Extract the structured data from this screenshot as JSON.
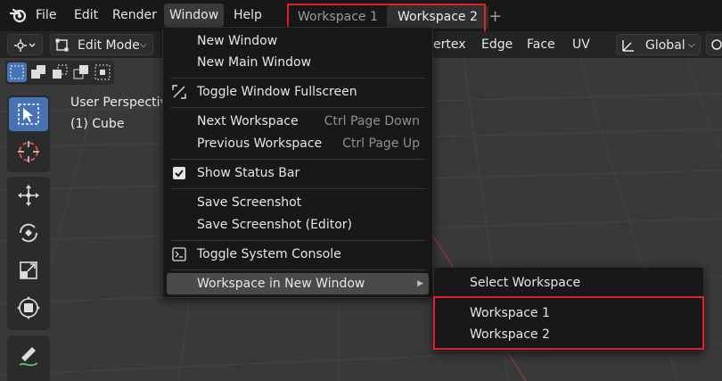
{
  "menubar": {
    "items": [
      "File",
      "Edit",
      "Render",
      "Window",
      "Help"
    ]
  },
  "workspaces": {
    "tabs": [
      "Workspace 1",
      "Workspace 2"
    ],
    "add_label": "+"
  },
  "header": {
    "mode": "Edit Mode",
    "menus": [
      "ertex",
      "Edge",
      "Face",
      "UV"
    ],
    "transform_orientation": "Global"
  },
  "viewport": {
    "view_name": "User Perspective",
    "object_name": "(1) Cube"
  },
  "window_menu": {
    "new_window": "New Window",
    "new_main_window": "New Main Window",
    "toggle_fullscreen": "Toggle Window Fullscreen",
    "next_workspace": "Next Workspace",
    "next_workspace_shortcut": "Ctrl Page Down",
    "previous_workspace": "Previous Workspace",
    "previous_workspace_shortcut": "Ctrl Page Up",
    "show_status_bar": "Show Status Bar",
    "save_screenshot": "Save Screenshot",
    "save_screenshot_editor": "Save Screenshot (Editor)",
    "toggle_console": "Toggle System Console",
    "workspace_in_new_window": "Workspace in New Window"
  },
  "submenu": {
    "select_workspace": "Select Workspace",
    "items": [
      "Workspace 1",
      "Workspace 2"
    ]
  },
  "colors": {
    "highlight_box": "#e0202a",
    "active_blue": "#4772b3"
  }
}
